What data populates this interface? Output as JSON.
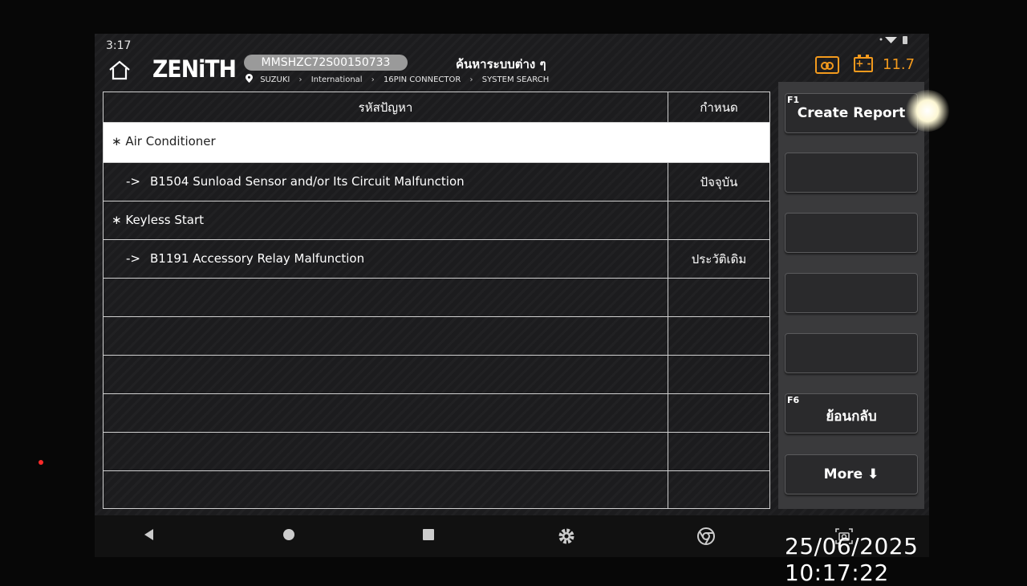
{
  "status_bar": {
    "time": "3:17"
  },
  "header": {
    "logo": "ZENiTH",
    "vin": "MMSHZC72S00150733",
    "title": "ค้นหาระบบต่าง ๆ",
    "breadcrumb": [
      "SUZUKI",
      "International",
      "16PIN CONNECTOR",
      "SYSTEM SEARCH"
    ],
    "voltage": "11.7",
    "accent_color": "#f39a1d"
  },
  "table": {
    "columns": [
      "รหัสปัญหา",
      "กำหนด"
    ],
    "rows": [
      {
        "kind": "group",
        "code": "Air Conditioner",
        "status": "",
        "selected": true
      },
      {
        "kind": "code",
        "code": "B1504 Sunload Sensor and/or Its Circuit Malfunction",
        "status": "ปัจจุบัน"
      },
      {
        "kind": "group",
        "code": "Keyless Start",
        "status": ""
      },
      {
        "kind": "code",
        "code": "B1191 Accessory Relay Malfunction",
        "status": "ประวัติเดิม"
      }
    ],
    "group_marker": "∗",
    "code_marker": "->"
  },
  "side_buttons": [
    {
      "key": "F1",
      "label": "Create Report"
    },
    {
      "key": "",
      "label": ""
    },
    {
      "key": "",
      "label": ""
    },
    {
      "key": "",
      "label": ""
    },
    {
      "key": "",
      "label": ""
    },
    {
      "key": "F6",
      "label": "ย้อนกลับ"
    },
    {
      "key": "",
      "label": "More ⬇"
    }
  ],
  "nav_icons": [
    "back-icon",
    "home-circle-icon",
    "recents-icon",
    "settings-gear-icon",
    "chrome-browser-icon",
    "screenshot-camera-icon"
  ],
  "overlay": {
    "timestamp": "25/06/2025 10:17:22"
  }
}
